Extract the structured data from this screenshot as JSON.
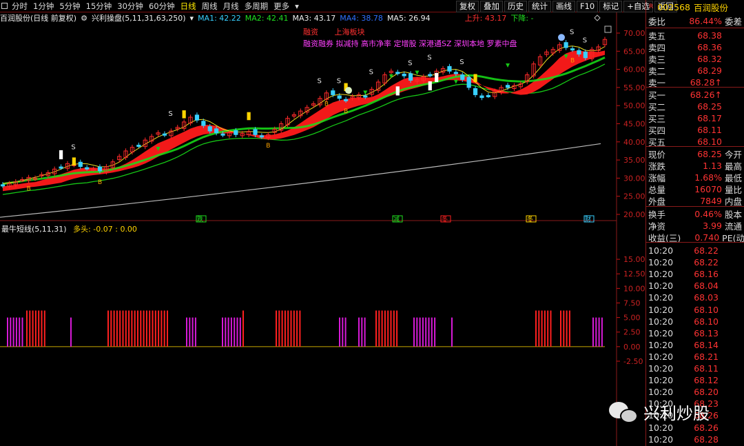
{
  "toolbar": {
    "periods": [
      "分时",
      "1分钟",
      "5分钟",
      "15分钟",
      "30分钟",
      "60分钟",
      "日线",
      "周线",
      "月线",
      "多周期",
      "更多"
    ],
    "active": "日线",
    "actions": [
      "复权",
      "叠加",
      "历史",
      "统计",
      "画线",
      "F10",
      "标记",
      "+自选",
      "返回"
    ]
  },
  "legend": {
    "stock": "百润股份(日线 前复权)",
    "indicator": "兴利操盘(5,11,31,63,250)",
    "ma1": "MA1: 42.22",
    "ma2": "MA2: 42.41",
    "ma3": "MA3: 43.17",
    "ma4": "MA4: 38.78",
    "ma5": "MA5: 26.94",
    "up": "上升: 43.17",
    "down": "下降: -"
  },
  "annotations": {
    "a1": "融资",
    "a2": "上海板块",
    "line2": "融资融券 拟减持 高市净率 定增股 深港通SZ 深圳本地 罗素中盘"
  },
  "date_marks": [
    "跌",
    "减",
    "冬",
    "冬",
    "财"
  ],
  "sub_legend": {
    "title": "最牛短线(5,11,31)",
    "text": "多头: -0.07  : 0.00"
  },
  "colors": {
    "up": "#ff2a2a",
    "down": "#38d0ff",
    "ma_green": "#16c716",
    "ma_gray": "#bdbdbd",
    "ma_yellow": "#f0e020",
    "bar_mag": "#d81ad8",
    "bar_red": "#ff2020"
  },
  "chart_data": [
    {
      "type": "candlestick",
      "title": "百润股份 日线",
      "ylim": [
        18,
        72
      ],
      "y_ticks": [
        "70.00",
        "65.00",
        "60.00",
        "55.00",
        "50.00",
        "45.00",
        "40.00",
        "35.00",
        "30.00",
        "25.00",
        "20.00"
      ],
      "close": [
        28.0,
        28.5,
        29.0,
        29.6,
        30.2,
        30.0,
        31.0,
        31.5,
        32.5,
        33.0,
        34.0,
        33.8,
        33.2,
        32.8,
        32.5,
        32.0,
        33.2,
        34.5,
        36.0,
        37.5,
        38.5,
        39.0,
        40.5,
        41.5,
        42.5,
        42.0,
        43.0,
        44.0,
        45.5,
        46.8,
        46.0,
        44.5,
        43.0,
        42.5,
        42.0,
        42.5,
        42.0,
        42.3,
        42.8,
        42.0,
        41.5,
        42.0,
        43.5,
        45.0,
        46.5,
        47.5,
        48.5,
        49.5,
        50.5,
        52.0,
        53.5,
        53.0,
        52.0,
        51.5,
        52.5,
        53.0,
        52.5,
        54.5,
        56.5,
        58.5,
        59.5,
        59.0,
        58.2,
        57.0,
        57.2,
        58.0,
        58.5,
        59.5,
        60.2,
        59.5,
        58.8,
        57.2,
        55.0,
        53.0,
        52.2,
        52.8,
        54.0,
        55.0,
        55.0,
        55.5,
        56.0,
        58.5,
        61.5,
        63.5,
        64.8,
        65.5,
        66.8,
        66.0,
        65.5,
        64.2,
        63.2,
        65.5,
        66.2,
        68.25
      ],
      "ma_gray": [
        19.2,
        39.5
      ],
      "signals": {
        "S": [
          14,
          32,
          61,
          64,
          70,
          78,
          82,
          88,
          108,
          111
        ],
        "B": [
          5,
          19,
          50,
          62,
          66,
          108
        ]
      }
    },
    {
      "type": "bar",
      "title": "最牛短线(5,11,31)",
      "ylim": [
        -2.5,
        19
      ],
      "y_ticks": [
        "15.00",
        "12.50",
        "10.00",
        "7.50",
        "5.00",
        "2.50",
        "0.00",
        "-2.50"
      ],
      "values_note": "bars at 5.00 (magenta) and 6.20 (red)"
    }
  ],
  "quote": {
    "code": "002568",
    "name": "百润股份",
    "weibi": {
      "label": "委比",
      "value": "86.44%",
      "right": "委差"
    },
    "asks": [
      {
        "label": "卖五",
        "value": "68.38"
      },
      {
        "label": "卖四",
        "value": "68.36"
      },
      {
        "label": "卖三",
        "value": "68.32"
      },
      {
        "label": "卖二",
        "value": "68.29"
      },
      {
        "label": "卖一",
        "value": "68.28↑"
      }
    ],
    "bids": [
      {
        "label": "买一",
        "value": "68.26↑"
      },
      {
        "label": "买二",
        "value": "68.25"
      },
      {
        "label": "买三",
        "value": "68.17"
      },
      {
        "label": "买四",
        "value": "68.11"
      },
      {
        "label": "买五",
        "value": "68.10"
      }
    ],
    "stats": [
      {
        "label": "现价",
        "value": "68.25",
        "right": "今开"
      },
      {
        "label": "涨跌",
        "value": "1.13",
        "right": "最高"
      },
      {
        "label": "涨幅",
        "value": "1.68%",
        "right": "最低"
      },
      {
        "label": "总量",
        "value": "16070",
        "right": "量比"
      },
      {
        "label": "外盘",
        "value": "7849",
        "right": "内盘"
      },
      {
        "label": "换手",
        "value": "0.46%",
        "right": "股本"
      },
      {
        "label": "净资",
        "value": "3.99",
        "right": "流通"
      },
      {
        "label": "收益(三)",
        "value": "0.740",
        "right": "PE(动"
      }
    ],
    "ticks": [
      {
        "t": "10:20",
        "p": "68.22"
      },
      {
        "t": "10:20",
        "p": "68.22"
      },
      {
        "t": "10:20",
        "p": "68.16"
      },
      {
        "t": "10:20",
        "p": "68.04"
      },
      {
        "t": "10:20",
        "p": "68.03"
      },
      {
        "t": "10:20",
        "p": "68.10"
      },
      {
        "t": "10:20",
        "p": "68.10"
      },
      {
        "t": "10:20",
        "p": "68.13"
      },
      {
        "t": "10:20",
        "p": "68.14"
      },
      {
        "t": "10:20",
        "p": "68.21"
      },
      {
        "t": "10:20",
        "p": "68.11"
      },
      {
        "t": "10:20",
        "p": "68.12"
      },
      {
        "t": "10:20",
        "p": "68.20"
      },
      {
        "t": "10:20",
        "p": "68.23"
      },
      {
        "t": "10:20",
        "p": "68.26"
      },
      {
        "t": "10:20",
        "p": "68.26"
      },
      {
        "t": "10:20",
        "p": "68.28"
      }
    ]
  },
  "watermark": "兴利炒股"
}
